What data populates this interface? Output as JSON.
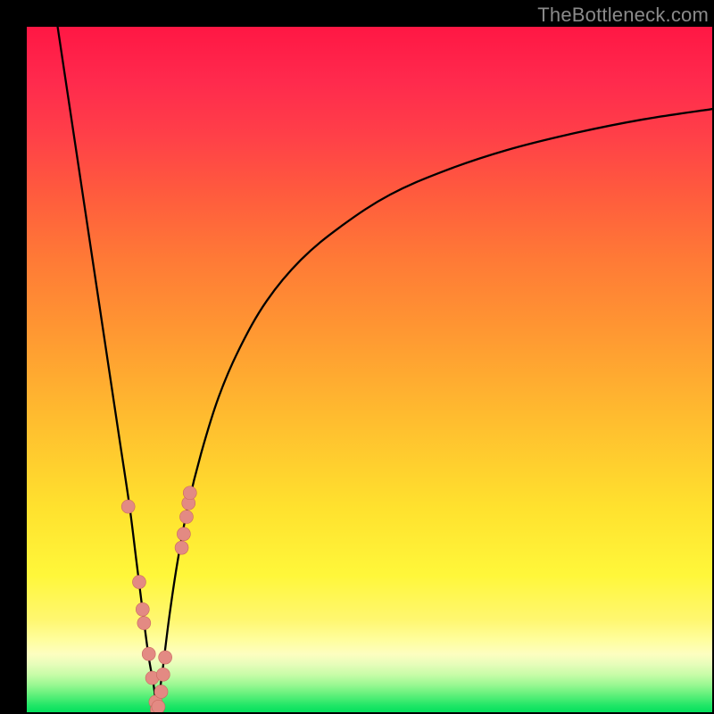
{
  "watermark": {
    "text": "TheBottleneck.com"
  },
  "colors": {
    "curve": "#000000",
    "marker_fill": "#e38a83",
    "marker_stroke": "#c96860",
    "frame": "#000000"
  },
  "chart_data": {
    "type": "line",
    "title": "",
    "xlabel": "",
    "ylabel": "",
    "xlim": [
      0,
      100
    ],
    "ylim": [
      0,
      100
    ],
    "grid": false,
    "series": [
      {
        "name": "left-branch",
        "x": [
          4.5,
          6,
          7.5,
          9,
          10.5,
          12,
          13.5,
          15,
          16,
          17,
          17.8,
          18.5,
          19
        ],
        "y": [
          100,
          90,
          80,
          70,
          60,
          50,
          40,
          30,
          22,
          14,
          8,
          4,
          0
        ]
      },
      {
        "name": "right-branch",
        "x": [
          19,
          19.8,
          20.8,
          22,
          23.5,
          25.5,
          28,
          31,
          35,
          40,
          46,
          53,
          61,
          70,
          80,
          90,
          100
        ],
        "y": [
          0,
          6,
          14,
          22,
          30,
          38,
          46,
          53,
          60,
          66,
          71,
          75.5,
          79,
          82,
          84.5,
          86.5,
          88
        ]
      }
    ],
    "markers": [
      {
        "name": "m1",
        "x": 14.8,
        "y": 30
      },
      {
        "name": "m2",
        "x": 16.4,
        "y": 19
      },
      {
        "name": "m3",
        "x": 16.9,
        "y": 15
      },
      {
        "name": "m4",
        "x": 17.1,
        "y": 13
      },
      {
        "name": "m5",
        "x": 17.8,
        "y": 8.5
      },
      {
        "name": "m6",
        "x": 18.3,
        "y": 5
      },
      {
        "name": "m7",
        "x": 18.8,
        "y": 1.5
      },
      {
        "name": "m8",
        "x": 19.0,
        "y": 0.4
      },
      {
        "name": "m9",
        "x": 19.2,
        "y": 0.8
      },
      {
        "name": "m10",
        "x": 19.6,
        "y": 3
      },
      {
        "name": "m11",
        "x": 19.9,
        "y": 5.5
      },
      {
        "name": "m12",
        "x": 20.2,
        "y": 8
      },
      {
        "name": "m13",
        "x": 22.6,
        "y": 24
      },
      {
        "name": "m14",
        "x": 22.9,
        "y": 26
      },
      {
        "name": "m15",
        "x": 23.3,
        "y": 28.5
      },
      {
        "name": "m16",
        "x": 23.6,
        "y": 30.5
      },
      {
        "name": "m17",
        "x": 23.8,
        "y": 32
      }
    ]
  }
}
